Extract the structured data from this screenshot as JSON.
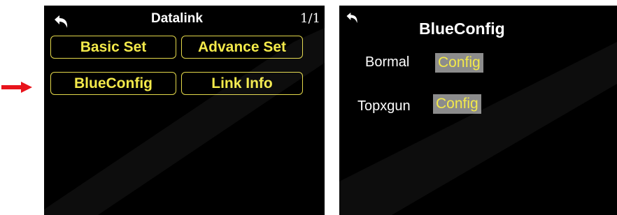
{
  "left_screen": {
    "title": "Datalink",
    "page_indicator": "1/1",
    "buttons": [
      {
        "label": "Basic Set"
      },
      {
        "label": "Advance Set"
      },
      {
        "label": "BlueConfig"
      },
      {
        "label": "Link Info"
      }
    ]
  },
  "right_screen": {
    "title": "BlueConfig",
    "rows": [
      {
        "label": "Bormal",
        "button": "Config"
      },
      {
        "label": "Topxgun",
        "button": "Config"
      }
    ]
  },
  "colors": {
    "screen_bg": "#000000",
    "accent_yellow": "#f3e94a",
    "config_bg": "#8c8c8c",
    "arrow_red": "#e8141c"
  },
  "icons": {
    "back": "back-arrow-icon",
    "pointer": "red-arrow-icon"
  }
}
